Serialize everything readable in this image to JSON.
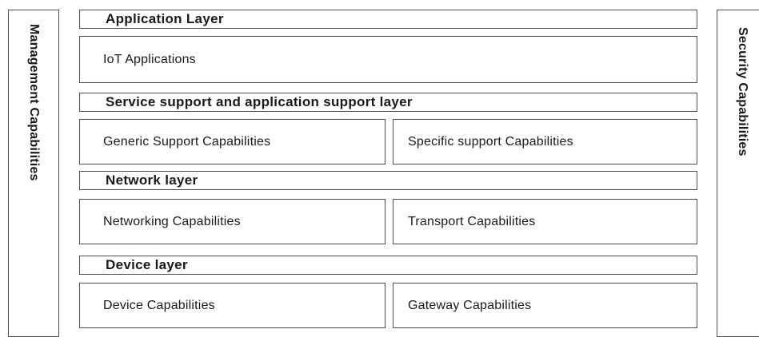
{
  "side_panels": {
    "management": "Management  Capabilities",
    "security": "Security  Capabilities"
  },
  "layers": {
    "application": {
      "header": "Application  Layer",
      "capabilities": [
        "IoT  Applications"
      ]
    },
    "service_support": {
      "header": "Service  support  and  application  support  layer",
      "capabilities": [
        "Generic  Support  Capabilities",
        "Specific  support  Capabilities"
      ]
    },
    "network": {
      "header": "Network  layer",
      "capabilities": [
        "Networking  Capabilities",
        "Transport  Capabilities"
      ]
    },
    "device": {
      "header": "Device  layer",
      "capabilities": [
        "Device  Capabilities",
        "Gateway  Capabilities"
      ]
    }
  }
}
